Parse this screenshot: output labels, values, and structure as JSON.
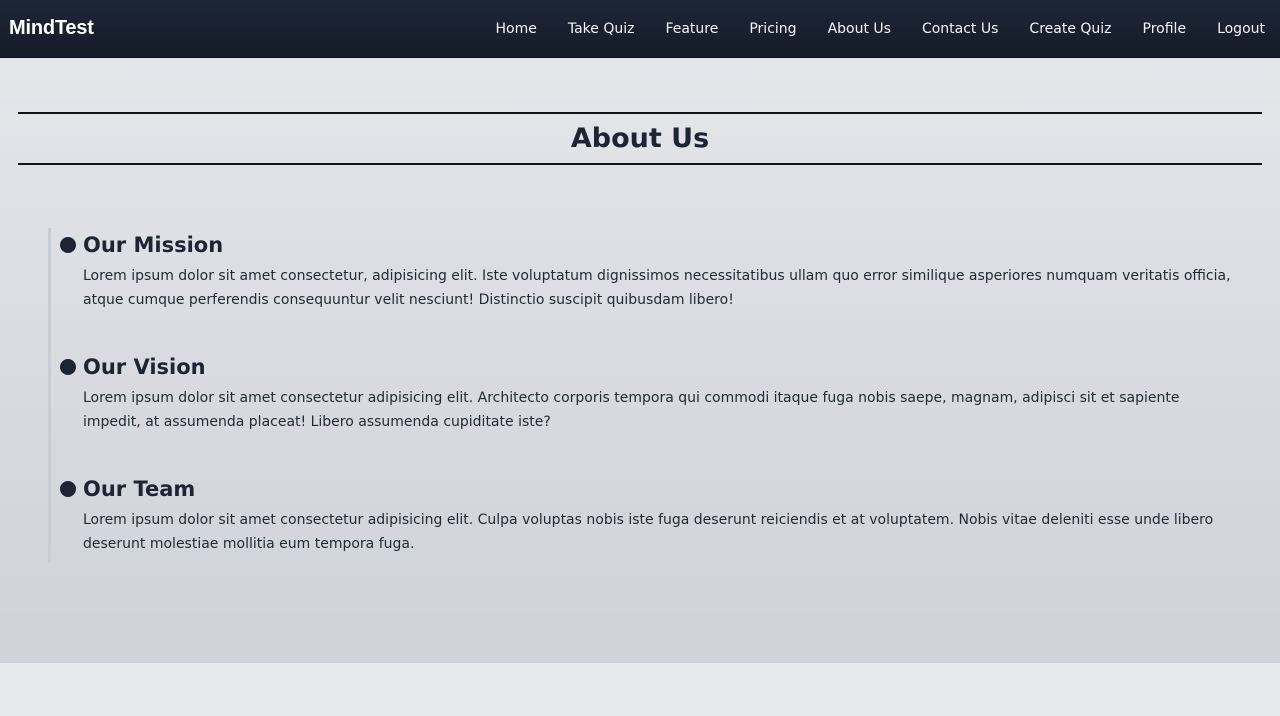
{
  "navbar": {
    "brand": "MindTest",
    "links": [
      {
        "label": "Home"
      },
      {
        "label": "Take Quiz"
      },
      {
        "label": "Feature"
      },
      {
        "label": "Pricing"
      },
      {
        "label": "About Us"
      },
      {
        "label": "Contact Us"
      },
      {
        "label": "Create Quiz"
      },
      {
        "label": "Profile"
      },
      {
        "label": "Logout"
      }
    ]
  },
  "main": {
    "title": "About Us",
    "sections": [
      {
        "title": "Our Mission",
        "body": "Lorem ipsum dolor sit amet consectetur, adipisicing elit. Iste voluptatum dignissimos necessitatibus ullam quo error similique asperiores numquam veritatis officia, atque cumque perferendis consequuntur velit nesciunt! Distinctio suscipit quibusdam libero!"
      },
      {
        "title": "Our Vision",
        "body": "Lorem ipsum dolor sit amet consectetur adipisicing elit. Architecto corporis tempora qui commodi itaque fuga nobis saepe, magnam, adipisci sit et sapiente impedit, at assumenda placeat! Libero assumenda cupiditate iste?"
      },
      {
        "title": "Our Team",
        "body": "Lorem ipsum dolor sit amet consectetur adipisicing elit. Culpa voluptas nobis iste fuga deserunt reiciendis et at voluptatem. Nobis vitae deleniti esse unde libero deserunt molestiae mollitia eum tempora fuga."
      }
    ]
  },
  "colors": {
    "navbar_bg": "#172030",
    "heading": "#1d2535",
    "page_bg": "#e8e9ed"
  }
}
